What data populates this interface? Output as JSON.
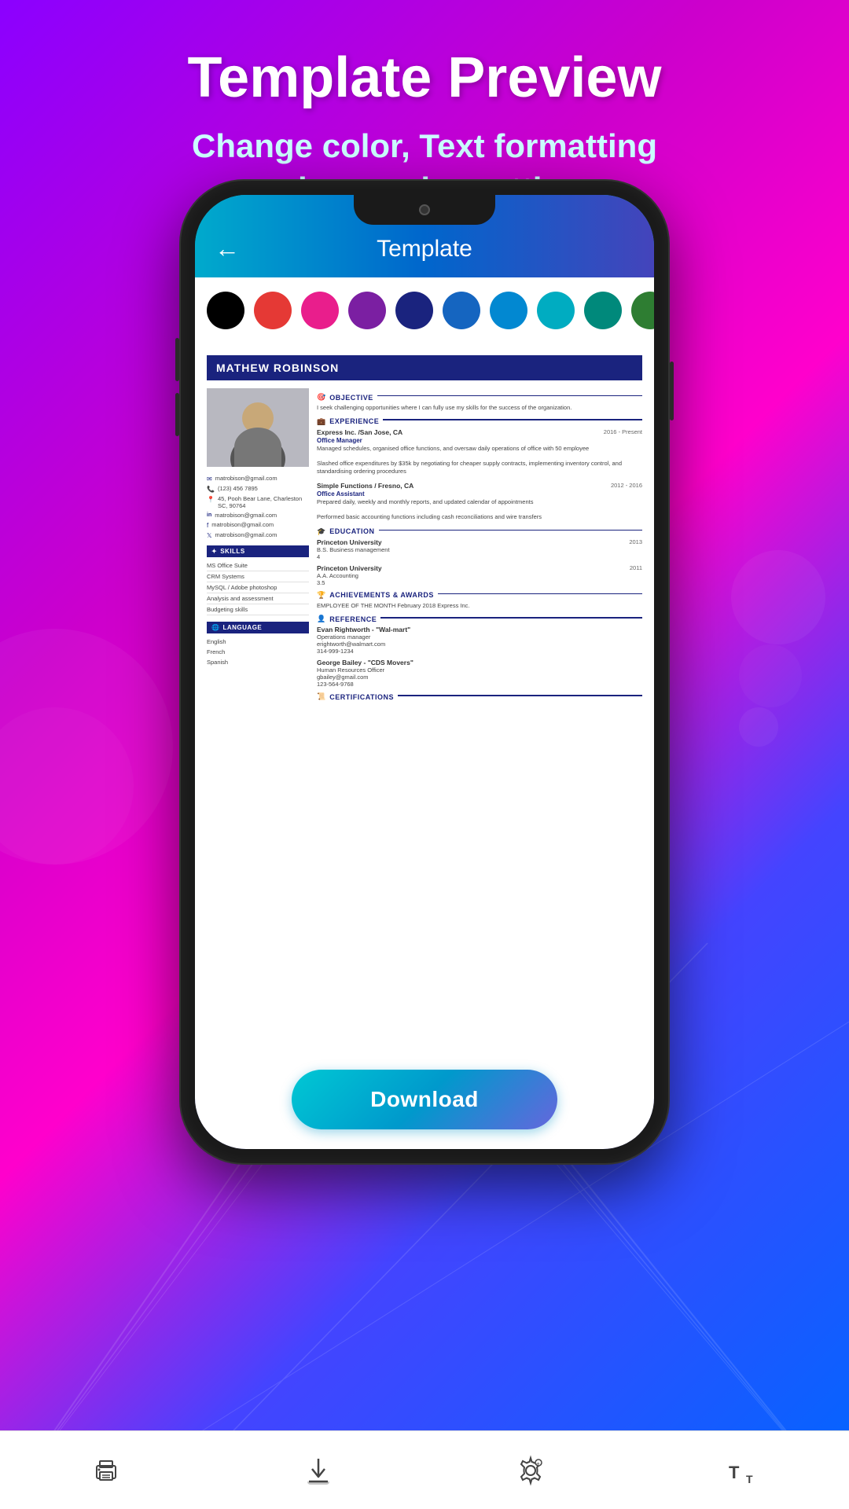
{
  "header": {
    "title": "Template Preview",
    "subtitle_line1": "Change color, Text formatting",
    "subtitle_line2": "and page size settings"
  },
  "app_bar": {
    "title": "Template",
    "back_label": "←"
  },
  "colors": [
    {
      "id": "black",
      "hex": "#000000",
      "selected": false
    },
    {
      "id": "red",
      "hex": "#E53935",
      "selected": false
    },
    {
      "id": "pink",
      "hex": "#E91E8C",
      "selected": false
    },
    {
      "id": "purple",
      "hex": "#7B1FA2",
      "selected": false
    },
    {
      "id": "dark-blue",
      "hex": "#1A237E",
      "selected": false
    },
    {
      "id": "blue",
      "hex": "#1565C0",
      "selected": false
    },
    {
      "id": "light-blue",
      "hex": "#0288D1",
      "selected": false
    },
    {
      "id": "cyan",
      "hex": "#00ACC1",
      "selected": false
    },
    {
      "id": "teal",
      "hex": "#00897B",
      "selected": false
    },
    {
      "id": "green",
      "hex": "#2E7D32",
      "selected": false
    }
  ],
  "resume": {
    "name": "MATHEW ROBINSON",
    "photo_alt": "Profile photo",
    "contact": {
      "email": "matrobison@gmail.com",
      "phone": "(123) 456 7895",
      "address": "45, Pooh Bear Lane, Charleston SC, 90764",
      "linkedin": "matrobison@gmail.com",
      "facebook": "matrobison@gmail.com",
      "twitter": "matrobison@gmail.com"
    },
    "skills": {
      "section_title": "SKILLS",
      "items": [
        "MS Office Suite",
        "CRM Systems",
        "MySQL / Adobe photoshop",
        "Analysis and assessment",
        "Budgeting skills"
      ]
    },
    "language": {
      "section_title": "LANGUAGE",
      "items": [
        "English",
        "French",
        "Spanish"
      ]
    },
    "objective": {
      "section_title": "OBJECTIVE",
      "text": "I seek challenging opportunities where I can fully use my skills for the success of the organization."
    },
    "experience": {
      "section_title": "EXPERIENCE",
      "items": [
        {
          "company": "Express Inc. /San Jose, CA",
          "date": "2016 - Present",
          "role": "Office Manager",
          "desc": "Managed schedules, organised office functions, and oversaw daily operations of office with 50 employee\n\nSlashed office expenditures by $35k by negotiating for cheaper supply contracts, implementing inventory control, and standardising ordering procedures"
        },
        {
          "company": "Simple Functions / Fresno, CA",
          "date": "2012 - 2016",
          "role": "Office Assistant",
          "desc": "Prepared daily, weekly and monthly reports, and updated calendar of appointments\n\nPerformed basic accounting functions including cash reconciliations and wire transfers"
        }
      ]
    },
    "education": {
      "section_title": "EDUCATION",
      "items": [
        {
          "school": "Princeton University",
          "date": "2013",
          "degree": "B.S. Business management",
          "gpa": "4"
        },
        {
          "school": "Princeton University",
          "date": "2011",
          "degree": "A.A. Accounting",
          "gpa": "3.5"
        }
      ]
    },
    "achievements": {
      "section_title": "ACHIEVEMENTS & AWARDS",
      "text": "EMPLOYEE OF THE MONTH February 2018 Express Inc."
    },
    "reference": {
      "section_title": "REFERENCE",
      "items": [
        {
          "name": "Evan Rightworth - \"Wal-mart\"",
          "role": "Operations manager",
          "email": "erightworth@walmart.com",
          "phone": "314-999-1234"
        },
        {
          "name": "George Bailey - \"CDS Movers\"",
          "role": "Human Resources Officer",
          "email": "gbailey@gmail.com",
          "phone": "123-564-9768"
        }
      ]
    },
    "certifications": {
      "section_title": "CERTIFICATIONS"
    }
  },
  "download": {
    "button_label": "Download"
  },
  "bottom_nav": {
    "print_icon": "🖨",
    "download_icon": "⬇",
    "settings_icon": "⚙",
    "text_size_icon": "T"
  }
}
